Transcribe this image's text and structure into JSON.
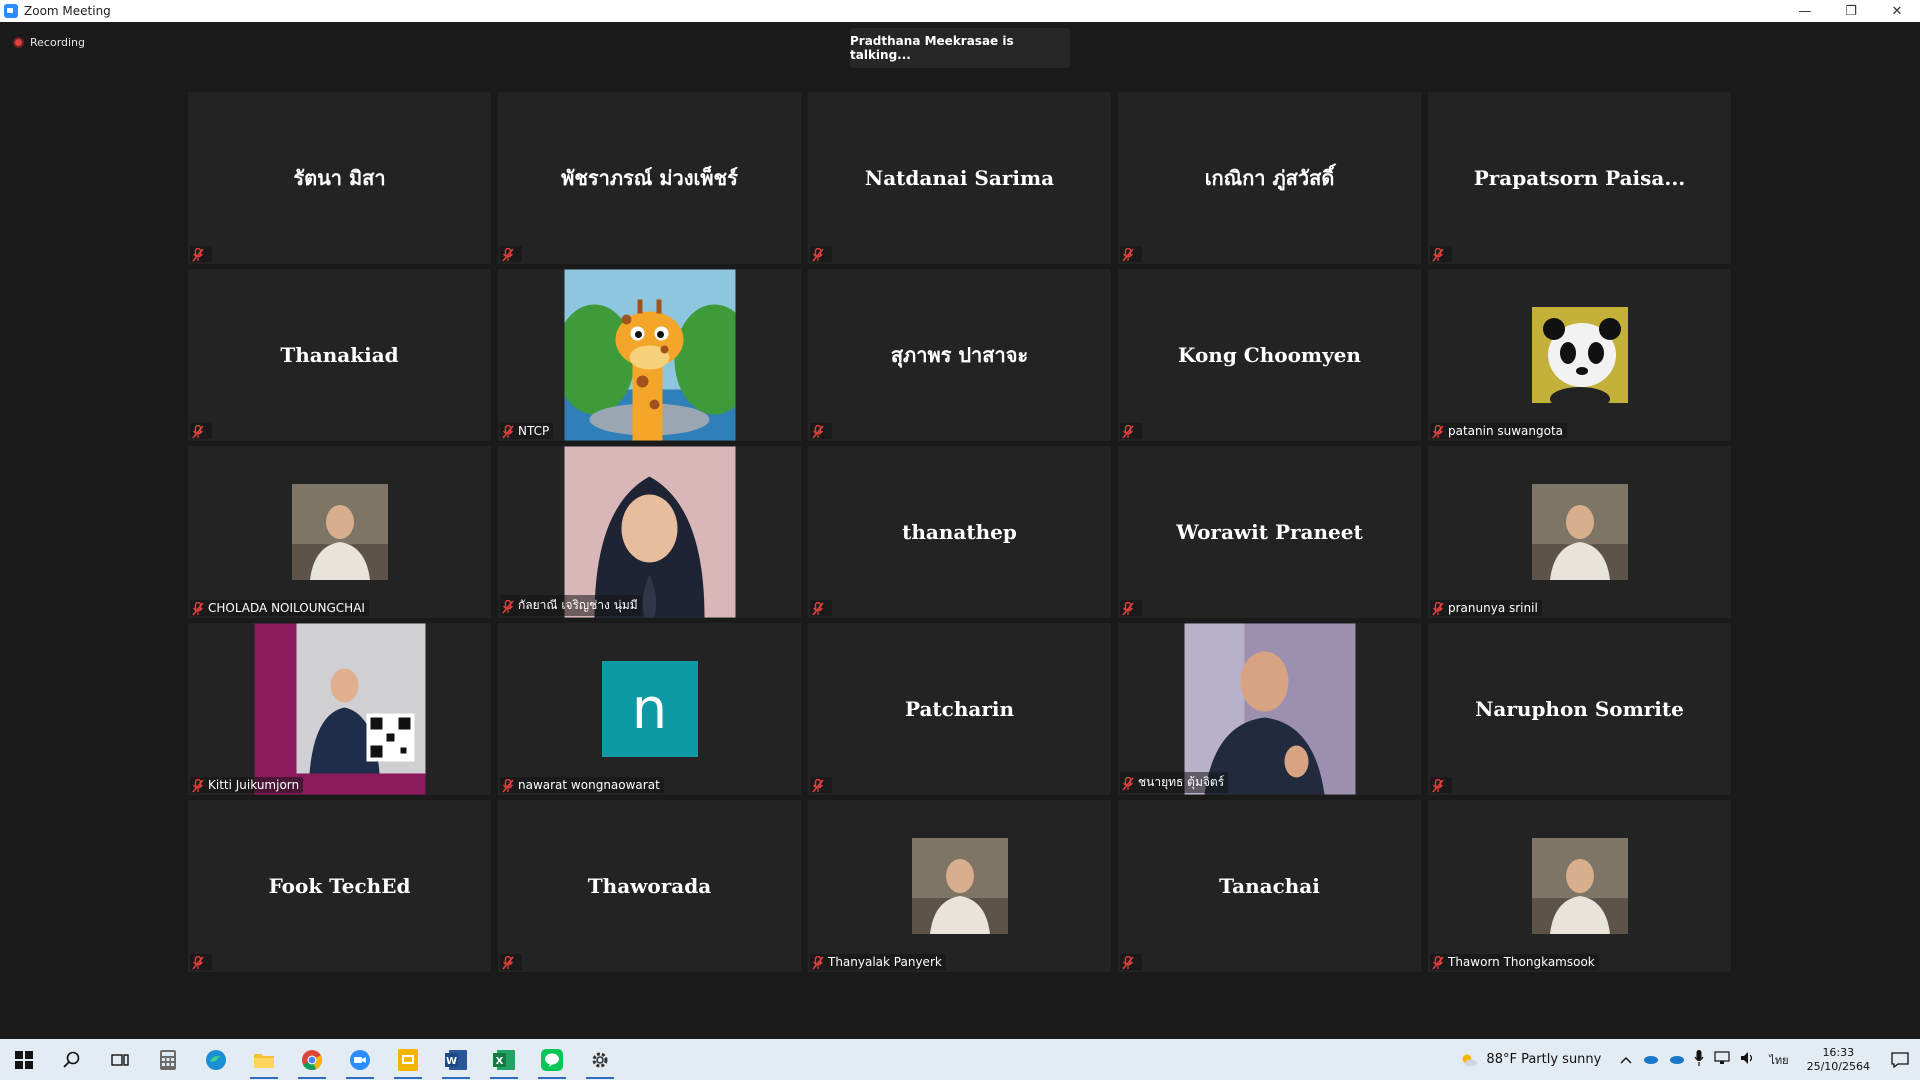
{
  "window": {
    "title": "Zoom Meeting",
    "minimize": "—",
    "restore": "❐",
    "close": "✕"
  },
  "meeting": {
    "recording_label": "Recording",
    "talking_banner": "Pradthana Meekrasae is talking..."
  },
  "tiles": [
    {
      "name": "รัตนา มิสา"
    },
    {
      "name": "พัชราภรณ์ ม่วงเพ็ชร์"
    },
    {
      "name": "Natdanai Sarima"
    },
    {
      "name": "เกณิกา ภู่สวัสดิ์"
    },
    {
      "name": "Prapatsorn Paisa..."
    },
    {
      "name": "Thanakiad"
    },
    {
      "label": "NTCP",
      "picture": "giraffe-cartoon-photo"
    },
    {
      "name": "สุภาพร ปาสาจะ"
    },
    {
      "name": "Kong Choomyen"
    },
    {
      "label": "patanin suwangota",
      "picture": "panda-photo"
    },
    {
      "label": "CHOLADA NOILOUNGCHAI",
      "picture": "person-photo"
    },
    {
      "label": "กัลยาณี เจริญช่าง นุ่มมี",
      "picture": "hijab-portrait-photo"
    },
    {
      "name": "thanathep"
    },
    {
      "name": "Worawit Praneet"
    },
    {
      "label": "pranunya srinil",
      "picture": "person-photo"
    },
    {
      "label": "Kitti Juikumjorn",
      "picture": "poster-photo"
    },
    {
      "label": "nawarat wongnaowarat",
      "avatar_letter": "n",
      "avatar_color": "#0d9aa5"
    },
    {
      "name": "Patcharin"
    },
    {
      "label": "ชนายุทธ ตุ้มจิตร์",
      "picture": "person-photo"
    },
    {
      "name": "Naruphon Somrite"
    },
    {
      "name": "Fook TechEd"
    },
    {
      "name": "Thaworada"
    },
    {
      "label": "Thanyalak Panyerk",
      "picture": "person-photo"
    },
    {
      "name": "Tanachai"
    },
    {
      "label": "Thaworn Thongkamsook",
      "picture": "person-photo"
    }
  ],
  "taskbar": {
    "weather": "88°F  Partly sunny",
    "language": "ไทย",
    "time": "16:33",
    "date": "25/10/2564",
    "apps": [
      "start-icon",
      "search-icon",
      "task-view-icon",
      "calculator-icon",
      "edge-icon",
      "file-explorer-icon",
      "chrome-icon",
      "zoom-icon",
      "slides-icon",
      "word-icon",
      "excel-icon",
      "line-icon",
      "settings-icon"
    ]
  },
  "colors": {
    "accent": "#2d8cff",
    "mute": "#e0413c",
    "tile_bg": "#232323"
  }
}
